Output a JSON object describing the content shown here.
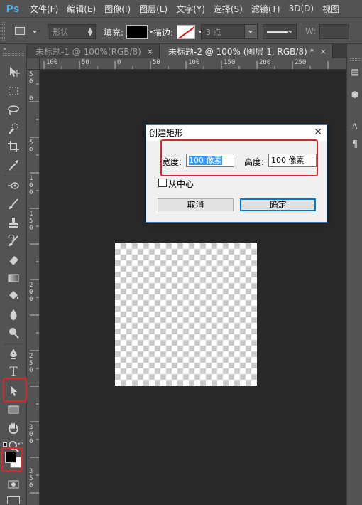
{
  "app": {
    "logo": "Ps",
    "menu": [
      "文件(F)",
      "编辑(E)",
      "图像(I)",
      "图层(L)",
      "文字(Y)",
      "选择(S)",
      "滤镜(T)",
      "3D(D)",
      "视图"
    ]
  },
  "options_bar": {
    "mode_select": "形状",
    "fill_label": "填充:",
    "stroke_label": "描边:",
    "stroke_width_value": "3 点",
    "w_label": "W:"
  },
  "tabs": [
    {
      "label": "未标题-1 @ 100%(RGB/8)",
      "close": "×"
    },
    {
      "label": "未标题-2 @ 100% (图层 1, RGB/8) *",
      "close": "×"
    }
  ],
  "ruler": {
    "h_labels": [
      "100",
      "50",
      "0",
      "50",
      "100",
      "150",
      "200",
      "250"
    ],
    "v_labels": [
      "5 0",
      "0",
      "5 0",
      "1 0 0",
      "1 5 0",
      "2 0 0",
      "2 5 0",
      "3 0 0",
      "3 5 0"
    ]
  },
  "dialog": {
    "title": "创建矩形",
    "close_glyph": "✕",
    "width_label": "宽度:",
    "width_value": "100 像素",
    "height_label": "高度:",
    "height_value": "100 像素",
    "from_center_label": "从中心",
    "from_center_checked": false,
    "cancel_label": "取消",
    "ok_label": "确定"
  },
  "tools": {
    "type_tool_glyph": "T"
  },
  "colors": {
    "highlight": "#d9262b",
    "foreground": "#000000",
    "background": "#ffffff"
  }
}
